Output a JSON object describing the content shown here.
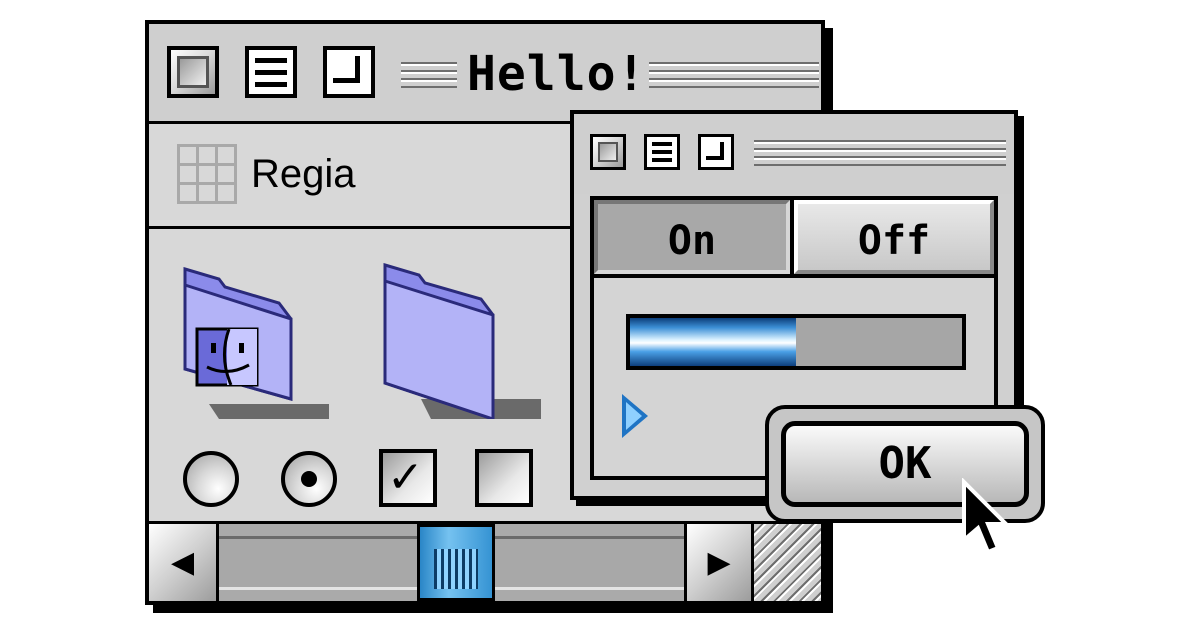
{
  "main_window": {
    "title": "Hello!",
    "header_label": "Regia",
    "controls": {
      "radio_1_selected": false,
      "radio_2_selected": true,
      "checkbox_1_checked": true,
      "checkbox_1_mark": "✓",
      "checkbox_2_checked": false
    },
    "scrollbar": {
      "left_arrow": "◀",
      "right_arrow": "▶"
    }
  },
  "dialog": {
    "segments": [
      {
        "label": "On",
        "selected": true
      },
      {
        "label": "Off",
        "selected": false
      }
    ],
    "progress": 0.5
  },
  "ok_button": {
    "label": "OK"
  },
  "colors": {
    "accent_blue": "#3593d3",
    "folder_purple": "#9d9df0",
    "window_gray": "#d4d4d4"
  }
}
